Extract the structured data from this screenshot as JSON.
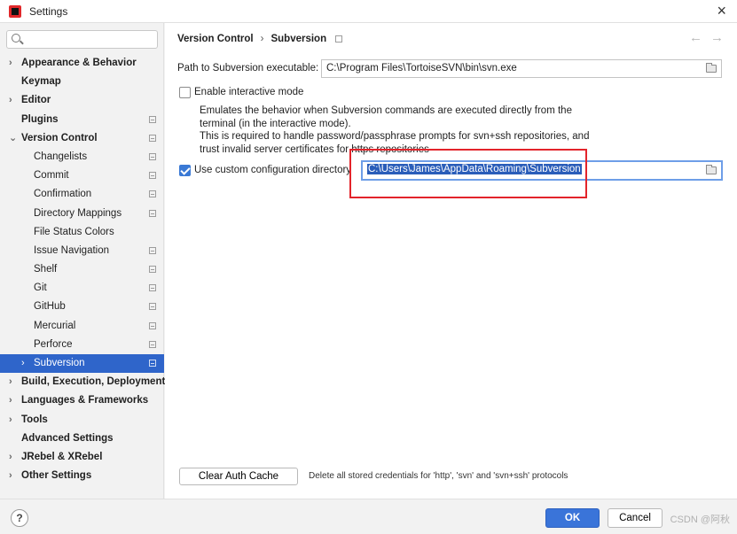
{
  "window": {
    "title": "Settings"
  },
  "search": {
    "value": "",
    "placeholder": ""
  },
  "sidebar": {
    "items": [
      {
        "label": "Appearance & Behavior",
        "chevron": "›",
        "bold": true,
        "child": false,
        "mark": false,
        "selected": false
      },
      {
        "label": "Keymap",
        "chevron": "",
        "bold": true,
        "child": false,
        "mark": false,
        "selected": false
      },
      {
        "label": "Editor",
        "chevron": "›",
        "bold": true,
        "child": false,
        "mark": false,
        "selected": false
      },
      {
        "label": "Plugins",
        "chevron": "",
        "bold": true,
        "child": false,
        "mark": true,
        "selected": false
      },
      {
        "label": "Version Control",
        "chevron": "⌄",
        "bold": true,
        "child": false,
        "mark": true,
        "selected": false
      },
      {
        "label": "Changelists",
        "chevron": "",
        "bold": false,
        "child": true,
        "mark": true,
        "selected": false
      },
      {
        "label": "Commit",
        "chevron": "",
        "bold": false,
        "child": true,
        "mark": true,
        "selected": false
      },
      {
        "label": "Confirmation",
        "chevron": "",
        "bold": false,
        "child": true,
        "mark": true,
        "selected": false
      },
      {
        "label": "Directory Mappings",
        "chevron": "",
        "bold": false,
        "child": true,
        "mark": true,
        "selected": false
      },
      {
        "label": "File Status Colors",
        "chevron": "",
        "bold": false,
        "child": true,
        "mark": false,
        "selected": false
      },
      {
        "label": "Issue Navigation",
        "chevron": "",
        "bold": false,
        "child": true,
        "mark": true,
        "selected": false
      },
      {
        "label": "Shelf",
        "chevron": "",
        "bold": false,
        "child": true,
        "mark": true,
        "selected": false
      },
      {
        "label": "Git",
        "chevron": "",
        "bold": false,
        "child": true,
        "mark": true,
        "selected": false
      },
      {
        "label": "GitHub",
        "chevron": "",
        "bold": false,
        "child": true,
        "mark": true,
        "selected": false
      },
      {
        "label": "Mercurial",
        "chevron": "",
        "bold": false,
        "child": true,
        "mark": true,
        "selected": false
      },
      {
        "label": "Perforce",
        "chevron": "",
        "bold": false,
        "child": true,
        "mark": true,
        "selected": false
      },
      {
        "label": "Subversion",
        "chevron": "›",
        "bold": false,
        "child": true,
        "mark": true,
        "selected": true
      },
      {
        "label": "Build, Execution, Deployment",
        "chevron": "›",
        "bold": true,
        "child": false,
        "mark": false,
        "selected": false
      },
      {
        "label": "Languages & Frameworks",
        "chevron": "›",
        "bold": true,
        "child": false,
        "mark": false,
        "selected": false
      },
      {
        "label": "Tools",
        "chevron": "›",
        "bold": true,
        "child": false,
        "mark": false,
        "selected": false
      },
      {
        "label": "Advanced Settings",
        "chevron": "",
        "bold": true,
        "child": false,
        "mark": false,
        "selected": false
      },
      {
        "label": "JRebel & XRebel",
        "chevron": "›",
        "bold": true,
        "child": false,
        "mark": false,
        "selected": false
      },
      {
        "label": "Other Settings",
        "chevron": "›",
        "bold": true,
        "child": false,
        "mark": false,
        "selected": false
      }
    ]
  },
  "breadcrumb": {
    "parent": "Version Control",
    "separator": "›",
    "current": "Subversion"
  },
  "nav": {
    "back": "←",
    "forward": "→"
  },
  "svn_path": {
    "label": "Path to Subversion executable:",
    "value": "C:\\Program Files\\TortoiseSVN\\bin\\svn.exe"
  },
  "interactive_mode": {
    "label": "Enable interactive mode",
    "checked": false,
    "description": [
      "Emulates the behavior when Subversion commands are executed directly from the",
      "terminal (in the interactive mode).",
      "This is required to handle password/passphrase prompts for svn+ssh repositories, and",
      "trust invalid server certificates for https repositories"
    ]
  },
  "custom_config": {
    "label": "Use custom configuration directory",
    "checked": true,
    "value": "C:\\Users\\James\\AppData\\Roaming\\Subversion"
  },
  "clear_auth": {
    "button_label": "Clear Auth Cache",
    "description": "Delete all stored credentials for 'http', 'svn' and 'svn+ssh' protocols"
  },
  "footer": {
    "help": "?",
    "ok_label": "OK",
    "cancel_label": "Cancel",
    "watermark": "CSDN @阿秋"
  },
  "colors": {
    "accent": "#3a74d9",
    "selection": "#2f65ca",
    "annotation": "#e3242b"
  }
}
